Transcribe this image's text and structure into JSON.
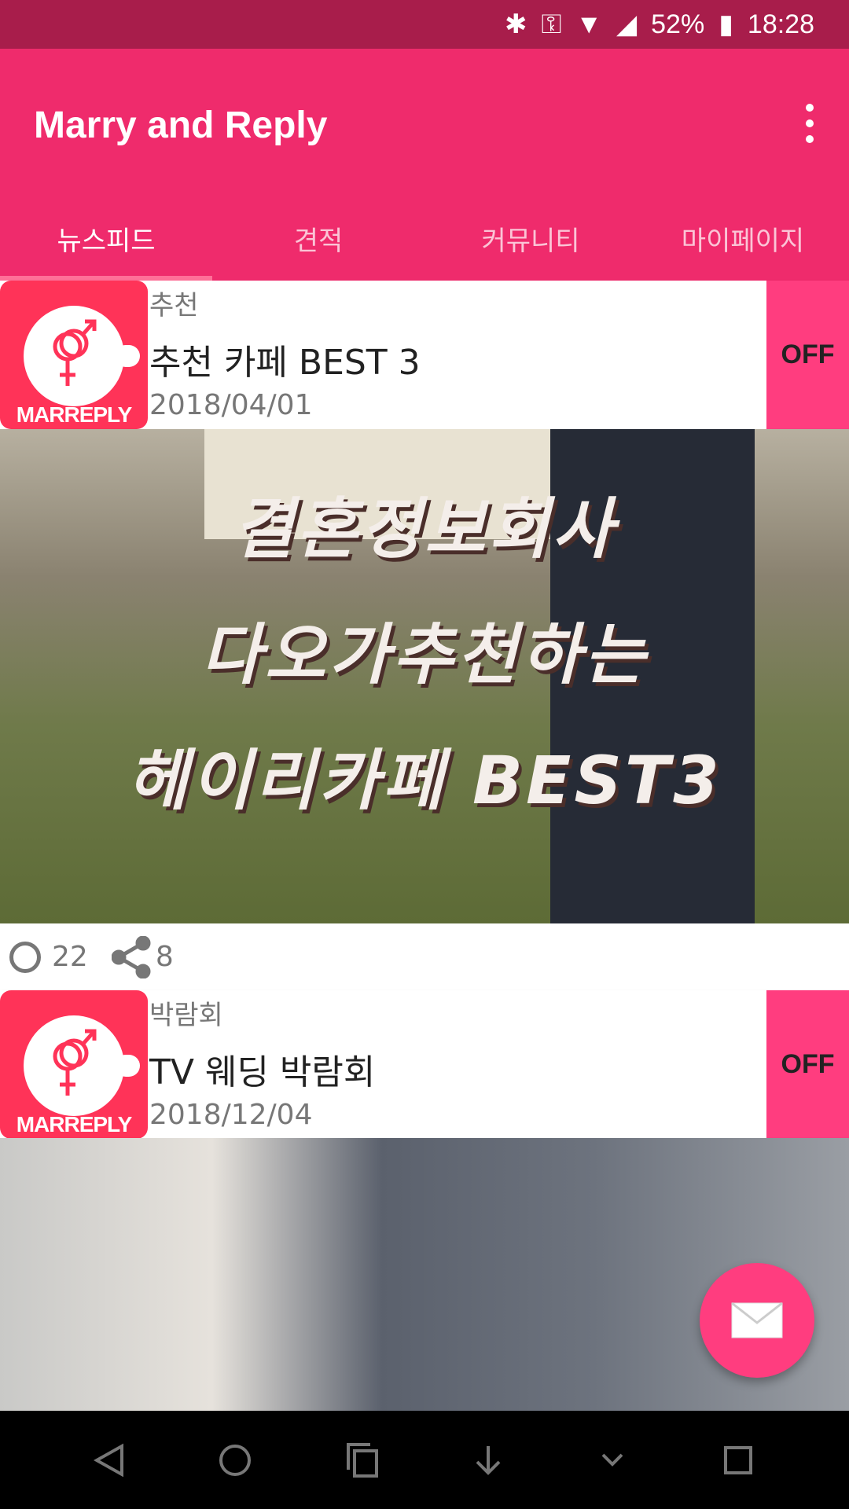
{
  "status_bar": {
    "battery": "52%",
    "time": "18:28",
    "icons": [
      "bluetooth-icon",
      "vpn-key-icon",
      "wifi-icon",
      "signal-icon",
      "battery-charging-icon"
    ]
  },
  "app_bar": {
    "title": "Marry and Reply",
    "menu_icon": "more-vert-icon"
  },
  "tabs": [
    {
      "label": "뉴스피드",
      "active": true
    },
    {
      "label": "견적"
    },
    {
      "label": "커뮤니티"
    },
    {
      "label": "마이페이지"
    }
  ],
  "feed": [
    {
      "logo_text": "MARREPLY",
      "category": "추천",
      "title": "추천 카페 BEST 3",
      "date": "2018/04/01",
      "badge": "OFF",
      "image_text": [
        "결혼정보회사",
        "다오가추천하는",
        "헤이리카페 BEST3"
      ],
      "comments": "22",
      "shares": "8"
    },
    {
      "logo_text": "MARREPLY",
      "category": "박람회",
      "title": "TV 웨딩 박람회",
      "date": "2018/12/04",
      "badge": "OFF"
    }
  ],
  "fab": {
    "icon": "mail-icon"
  },
  "nav_bar": {
    "icons": [
      "back-icon",
      "home-icon",
      "recents-icon",
      "download-icon",
      "collapse-icon",
      "square-icon"
    ]
  },
  "colors": {
    "primary": "#ef2b6c",
    "status": "#a81d4b",
    "accent": "#ff3d7f"
  }
}
